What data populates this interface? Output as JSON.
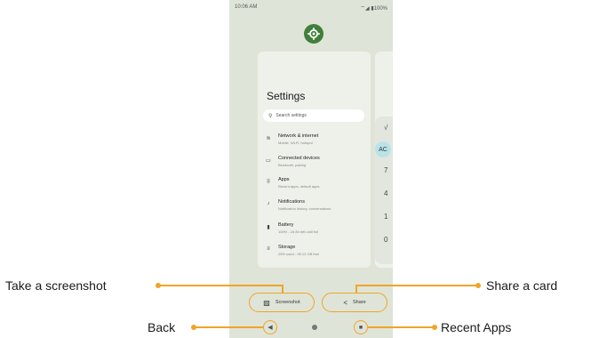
{
  "status_bar": {
    "time": "10:06 AM",
    "icons": "⌔◢ ▮100%"
  },
  "settings_card": {
    "title": "Settings",
    "search_placeholder": "Search settings",
    "items": [
      {
        "title": "Network & internet",
        "subtitle": "Mobile, Wi-Fi, hotspot",
        "icon": "wifi-icon",
        "glyph": "≋"
      },
      {
        "title": "Connected devices",
        "subtitle": "Bluetooth, pairing",
        "icon": "devices-icon",
        "glyph": "▭"
      },
      {
        "title": "Apps",
        "subtitle": "Recent apps, default apps",
        "icon": "apps-icon",
        "glyph": "⠿"
      },
      {
        "title": "Notifications",
        "subtitle": "Notification history, conversations",
        "icon": "bell-icon",
        "glyph": "♪"
      },
      {
        "title": "Battery",
        "subtitle": "100% - 2d 8h left until full",
        "icon": "battery-icon",
        "glyph": "▮"
      },
      {
        "title": "Storage",
        "subtitle": "25% used - 95.13 GB free",
        "icon": "storage-icon",
        "glyph": "≡"
      }
    ]
  },
  "calculator_card": {
    "keys": [
      "√",
      "AC",
      "7",
      "4",
      "1",
      "0"
    ]
  },
  "actions": {
    "screenshot_label": "Screenshot",
    "share_label": "Share"
  },
  "callouts": {
    "take_screenshot": "Take a screenshot",
    "share_card": "Share a card",
    "back": "Back",
    "recent_apps": "Recent Apps"
  },
  "colors": {
    "accent": "#f0a526",
    "screen_bg": "#dfe4d8",
    "settings_icon": "#3f7f3a"
  }
}
